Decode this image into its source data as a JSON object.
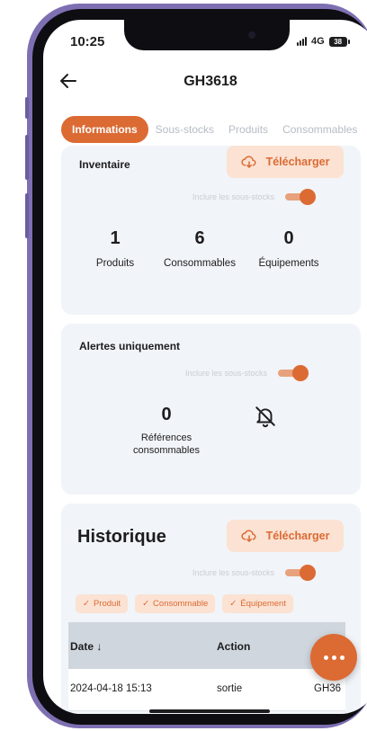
{
  "status_bar": {
    "time": "10:25",
    "network": "4G",
    "battery": "38"
  },
  "header": {
    "title": "GH3618"
  },
  "tabs": [
    {
      "label": "Informations",
      "active": true
    },
    {
      "label": "Sous-stocks"
    },
    {
      "label": "Produits"
    },
    {
      "label": "Consommables"
    }
  ],
  "inventory": {
    "title": "Inventaire",
    "download_label": "Télécharger",
    "include_label": "Inclure les sous-stocks",
    "include_on": true,
    "stats": [
      {
        "value": "1",
        "label": "Produits"
      },
      {
        "value": "6",
        "label": "Consommables"
      },
      {
        "value": "0",
        "label": "Équipements"
      }
    ]
  },
  "alerts": {
    "title": "Alertes uniquement",
    "include_label": "Inclure les sous-stocks",
    "include_on": true,
    "count": "0",
    "count_label_line1": "Références",
    "count_label_line2": "consommables"
  },
  "history": {
    "title": "Historique",
    "download_label": "Télécharger",
    "include_label": "Inclure les sous-stocks",
    "include_on": true,
    "filters": [
      "Produit",
      "Consommable",
      "Équipement"
    ],
    "columns": [
      "Date",
      "Action",
      ""
    ],
    "rows": [
      {
        "date": "2024-04-18 15:13",
        "action": "sortie",
        "ref": "GH36"
      }
    ]
  },
  "colors": {
    "accent": "#dc6a33",
    "accent_light": "#fbe2d3",
    "card_bg": "#f1f4f8"
  },
  "icons": [
    "back-arrow-icon",
    "cloud-download-icon",
    "bell-off-icon",
    "sort-down-icon",
    "more-icon",
    "check-icon"
  ]
}
